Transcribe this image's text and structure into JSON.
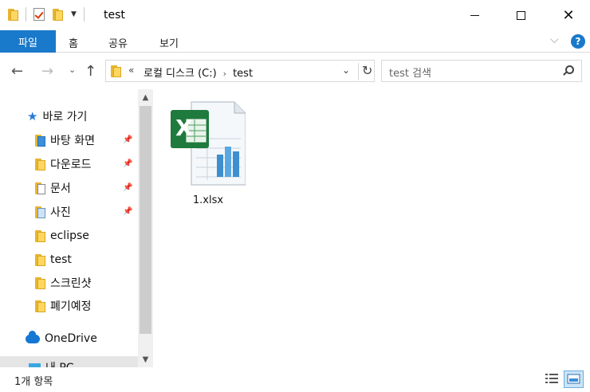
{
  "window": {
    "title": "test",
    "close_glyph": "✕"
  },
  "ribbon": {
    "file_tab": "파일",
    "tabs": [
      "홈",
      "공유",
      "보기"
    ],
    "help": "?"
  },
  "navigation": {
    "back_glyph": "←",
    "forward_glyph": "→",
    "recent_glyph": "⌄",
    "up_glyph": "↑",
    "address": {
      "overflow_glyph": "«",
      "segments": [
        "로컬 디스크 (C:)",
        "test"
      ],
      "separator": "›",
      "dropdown_glyph": "⌄",
      "refresh_glyph": "↻"
    },
    "search": {
      "placeholder": "test 검색"
    }
  },
  "sidebar": {
    "quick_access": "바로 가기",
    "items": [
      {
        "label": "바탕 화면",
        "pinned": true,
        "icon": "desktop-folder-icon"
      },
      {
        "label": "다운로드",
        "pinned": true,
        "icon": "downloads-folder-icon"
      },
      {
        "label": "문서",
        "pinned": true,
        "icon": "documents-folder-icon"
      },
      {
        "label": "사진",
        "pinned": true,
        "icon": "pictures-folder-icon"
      },
      {
        "label": "eclipse",
        "pinned": false,
        "icon": "folder-icon"
      },
      {
        "label": "test",
        "pinned": false,
        "icon": "folder-icon"
      },
      {
        "label": "스크린샷",
        "pinned": false,
        "icon": "folder-icon"
      },
      {
        "label": "폐기예정",
        "pinned": false,
        "icon": "folder-icon"
      }
    ],
    "onedrive": "OneDrive",
    "this_pc": "내 PC",
    "pin_glyph": "📌"
  },
  "files": [
    {
      "name": "1.xlsx",
      "icon": "excel-file-icon"
    }
  ],
  "status": {
    "item_count": "1개 항목"
  },
  "colors": {
    "accent": "#1979ca",
    "folder": "#ffd75e",
    "excel_green": "#1f7a3d"
  }
}
